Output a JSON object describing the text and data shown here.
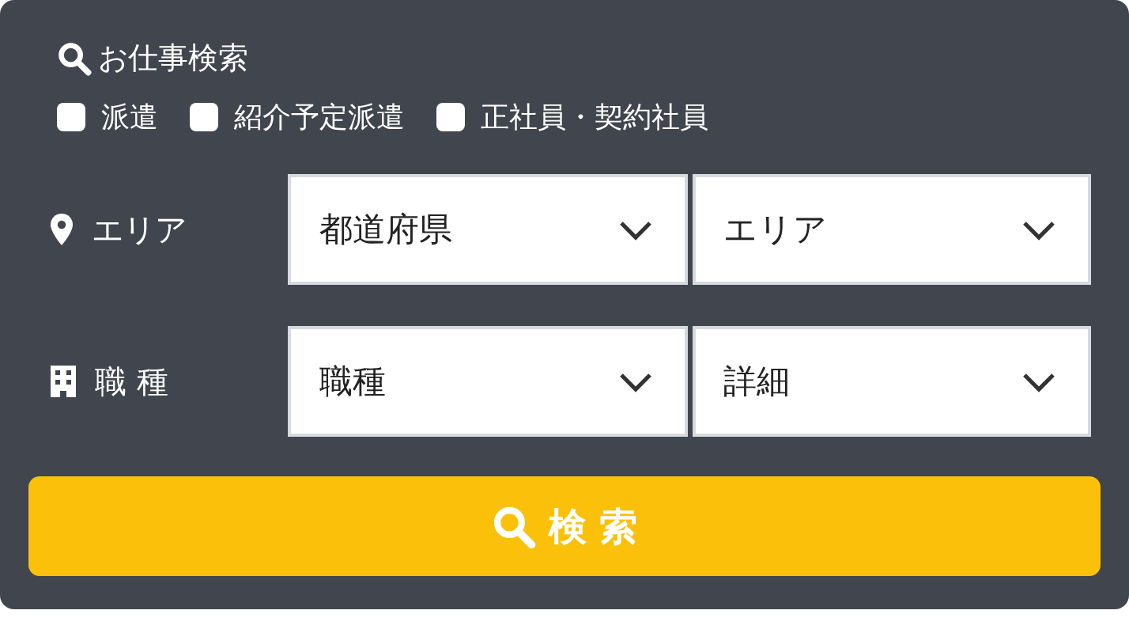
{
  "header": {
    "title": "お仕事検索"
  },
  "filters": [
    {
      "label": "派遣",
      "checked": false
    },
    {
      "label": "紹介予定派遣",
      "checked": false
    },
    {
      "label": "正社員・契約社員",
      "checked": false
    }
  ],
  "fields": [
    {
      "kind": "area",
      "label": "エリア",
      "selects": [
        {
          "value": "都道府県"
        },
        {
          "value": "エリア"
        }
      ]
    },
    {
      "kind": "job",
      "label": "職 種",
      "selects": [
        {
          "value": "職種"
        },
        {
          "value": "詳細"
        }
      ]
    }
  ],
  "search_button": {
    "label": "検 索"
  }
}
